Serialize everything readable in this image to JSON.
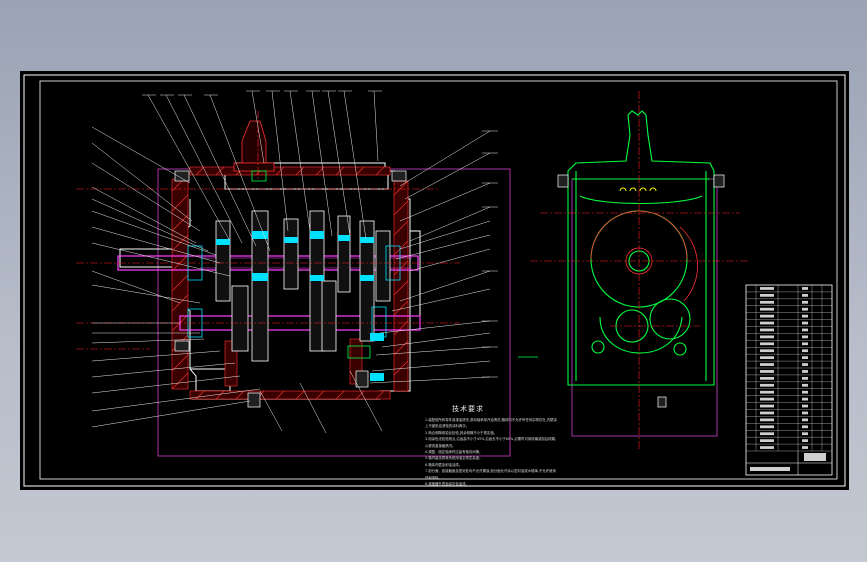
{
  "viewer": {
    "background": "#9aa3b4",
    "canvas_color": "#000000"
  },
  "drawing": {
    "colors": {
      "frame": "#ffffff",
      "outline": "#ffffff",
      "section_hatch": "#ff3030",
      "centerline": "#ff2020",
      "shaft": "#ff40ff",
      "gear": "#00e0ff",
      "green_body": "#00ff40",
      "leader": "#e8e8e8",
      "magenta_box": "#d040d0",
      "yellow": "#ffff00"
    },
    "notes_title": "技术要求",
    "notes": [
      "1.装配前所有零件用煤油清洗,滚动轴承用汽油清洗,箱体内不允许有任何杂物存在,内壁涂",
      "  上不被机油浸蚀的涂料两次。",
      "2.啮合侧隙用铅丝检验,其余侧隙不小于规定值。",
      "3.用涂色法检验斑点,沿齿高不小于45%,沿齿长不小于60%,必要时可用研磨或刮后研磨,",
      "  以便改善接触情况。",
      "4.调整、固定轴承时应留有轴向间隙。",
      "5.箱内装全损耗系统用油至规定高度。",
      "6.箱体内壁涂耐油油漆。",
      "7.剖分面、各接触面及密封处均不允许漏油,剖分面允许涂以密封油或水玻璃,不允许使用",
      "  任何填料。",
      "8.减速器外表面涂灰色油漆。"
    ],
    "title_block": {
      "rows": 24
    }
  }
}
